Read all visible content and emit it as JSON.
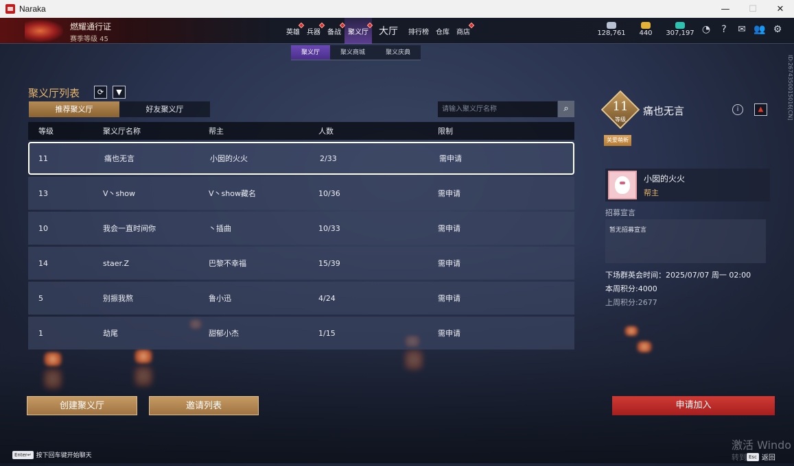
{
  "window": {
    "title": "Naraka",
    "minimize": "—",
    "maximize": "☐",
    "close": "✕"
  },
  "battle_pass": {
    "title": "燃耀通行证",
    "level": "赛季等级 45"
  },
  "nav": {
    "items": [
      {
        "label": "英雄",
        "badge": true
      },
      {
        "label": "兵器",
        "badge": true
      },
      {
        "label": "备战",
        "badge": true
      },
      {
        "label": "聚义厅",
        "badge": true,
        "active": true
      },
      {
        "label": "大厅",
        "badge": false,
        "big": true
      },
      {
        "label": "排行榜",
        "badge": false
      },
      {
        "label": "仓库",
        "badge": false
      },
      {
        "label": "商店",
        "badge": true
      }
    ]
  },
  "currencies": [
    {
      "icon": "silver-coin-icon",
      "value": "128,761"
    },
    {
      "icon": "gold-coin-icon",
      "value": "440"
    },
    {
      "icon": "feather-icon",
      "value": "307,197"
    }
  ],
  "subtabs": [
    {
      "label": "聚义厅",
      "active": true
    },
    {
      "label": "聚义商城"
    },
    {
      "label": "聚义庆典"
    }
  ],
  "side_id": "ID:2674350015016[CN]",
  "list": {
    "title": "聚义厅列表",
    "tab_recommended": "推荐聚义厅",
    "tab_friends": "好友聚义厅",
    "search_placeholder": "请输入聚义厅名称",
    "columns": {
      "level": "等级",
      "name": "聚义厅名称",
      "leader": "帮主",
      "members": "人数",
      "limit": "限制"
    },
    "rows": [
      {
        "level": "11",
        "name": "痛也无言",
        "leader": "小囡的火火",
        "members": "2/33",
        "limit": "需申请"
      },
      {
        "level": "13",
        "name": "V丶show",
        "leader": "V丶show藏名",
        "members": "10/36",
        "limit": "需申请"
      },
      {
        "level": "10",
        "name": "我会一直时间你",
        "leader": "丶插曲",
        "members": "10/33",
        "limit": "需申请"
      },
      {
        "level": "14",
        "name": "staer.Z",
        "leader": "巴黎不幸福",
        "members": "15/39",
        "limit": "需申请"
      },
      {
        "level": "5",
        "name": "别振我熬",
        "leader": "鲁小迅",
        "members": "4/24",
        "limit": "需申请"
      },
      {
        "level": "1",
        "name": "劫尾",
        "leader": "甜郁小杰",
        "members": "1/15",
        "limit": "需申请"
      }
    ]
  },
  "detail": {
    "level": "11",
    "level_label": "等级",
    "name": "痛也无言",
    "tag": "关爱萌新",
    "leader_name": "小囡的火火",
    "leader_role": "帮主",
    "recruit_label": "招募宣言",
    "recruit_text": "暂无招募宣言",
    "meet_time": "下场群英会时间：2025/07/07 周一 02:00",
    "week_score": "本周积分:4000",
    "last_week_score": "上周积分:2677"
  },
  "buttons": {
    "create": "创建聚义厅",
    "invites": "邀请列表",
    "apply": "申请加入"
  },
  "chat_hint": {
    "key": "Enter↵",
    "text": "按下回车键开始聊天"
  },
  "esc_hint": {
    "key": "Esc",
    "text": "返回"
  },
  "watermark": {
    "line1": "激活 Windo",
    "line2": "转到"
  }
}
